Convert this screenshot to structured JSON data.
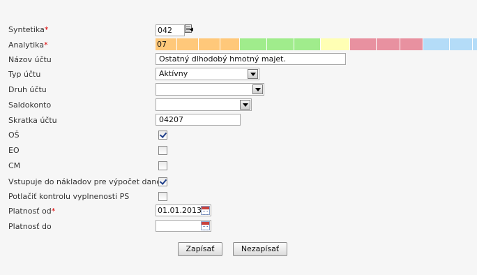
{
  "fields": {
    "syntetika": {
      "label": "Syntetika",
      "required_mark": "*",
      "value": "042",
      "icon": "lookup-icon"
    },
    "analytika": {
      "label": "Analytika",
      "required_mark": "*",
      "value": "07",
      "colors": [
        "#ffc87a",
        "#ffc87a",
        "#ffc87a",
        "#ffc87a",
        "#a0ec8c",
        "#a0ec8c",
        "#a0ec8c",
        "#ffffb4",
        "#e891a0",
        "#e891a0",
        "#e891a0",
        "#b4dcf8",
        "#b4dcf8",
        "#b4dcf8"
      ]
    },
    "nazov_uctu": {
      "label": "Názov účtu",
      "value": "Ostatný dlhodobý hmotný majet."
    },
    "typ_uctu": {
      "label": "Typ účtu",
      "value": "Aktívny"
    },
    "druh_uctu": {
      "label": "Druh účtu",
      "value": ""
    },
    "saldokonto": {
      "label": "Saldokonto",
      "value": ""
    },
    "skratka_uctu": {
      "label": "Skratka účtu",
      "value": "04207"
    },
    "os": {
      "label": "OŠ",
      "checked": true
    },
    "eo": {
      "label": "EO",
      "checked": false
    },
    "cm": {
      "label": "CM",
      "checked": false
    },
    "vstupuje": {
      "label": "Vstupuje do nákladov pre výpočet dane",
      "checked": true
    },
    "potlacit": {
      "label": "Potlačiť kontrolu vyplnenosti PS",
      "checked": false
    },
    "platnost_od": {
      "label": "Platnosť od",
      "required_mark": "*",
      "value": "01.01.2013",
      "icon": "calendar-icon"
    },
    "platnost_do": {
      "label": "Platnosť do",
      "value": "",
      "icon": "calendar-icon"
    }
  },
  "buttons": {
    "save": "Zapísať",
    "cancel": "Nezapísať"
  }
}
